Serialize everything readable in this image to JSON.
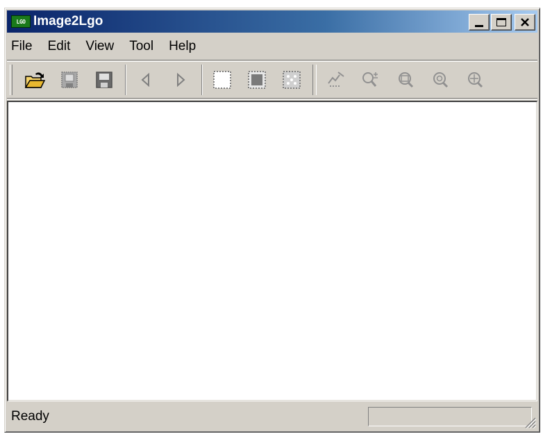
{
  "window": {
    "title": "Image2Lgo",
    "icon_text": "LGO",
    "icon_name": "app-logo-icon"
  },
  "title_buttons": [
    "minimize-icon",
    "maximize-icon",
    "close-icon"
  ],
  "menu": [
    {
      "label": "File"
    },
    {
      "label": "Edit"
    },
    {
      "label": "View"
    },
    {
      "label": "Tool"
    },
    {
      "label": "Help"
    }
  ],
  "toolbar": {
    "groups": [
      [
        "open-folder-icon",
        "save-disabled-icon",
        "save-icon"
      ],
      [
        "previous-icon",
        "next-icon"
      ],
      [
        "select-rect-icon",
        "fill-rect-icon",
        "select-dots-icon"
      ],
      [
        "draw-tool-icon",
        "zoom-in-out-icon",
        "zoom-fit-icon",
        "zoom-actual-icon",
        "zoom-pan-icon"
      ]
    ]
  },
  "status": {
    "text": "Ready"
  },
  "colors": {
    "face": "#d4d0c8",
    "title_start": "#0a246a",
    "title_end": "#a6caf0",
    "client": "#ffffff"
  }
}
